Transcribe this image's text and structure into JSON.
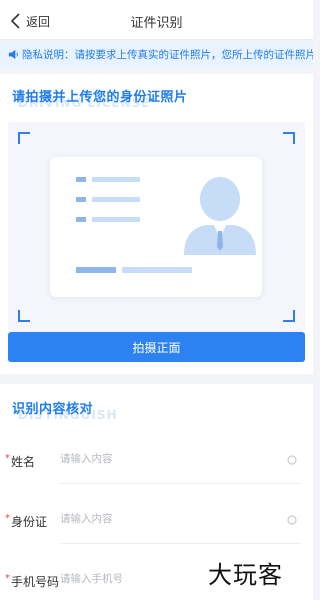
{
  "nav": {
    "back_label": "返回",
    "title": "证件识别"
  },
  "notice": {
    "text": "隐私说明：请按要求上传真实的证件照片，您所上传的证件照片仅用于身份核验"
  },
  "upload": {
    "title": "请拍摄并上传您的身份证照片",
    "watermark": "DRIVING LICENSE",
    "button_label": "拍摄正面"
  },
  "verify": {
    "title": "识别内容核对",
    "watermark": "DISTINGUISH",
    "required_mark": "*",
    "fields": [
      {
        "label": "姓名",
        "placeholder": "请输入内容"
      },
      {
        "label": "身份证",
        "placeholder": "请输入内容"
      },
      {
        "label": "手机号码",
        "placeholder": "请输入手机号"
      }
    ]
  },
  "brand": {
    "text": "大玩客"
  },
  "colors": {
    "accent": "#2c82f1",
    "notice_bg": "#e9f3ff",
    "required": "#e84a4a",
    "card_illustration": "#c6dcf7"
  }
}
